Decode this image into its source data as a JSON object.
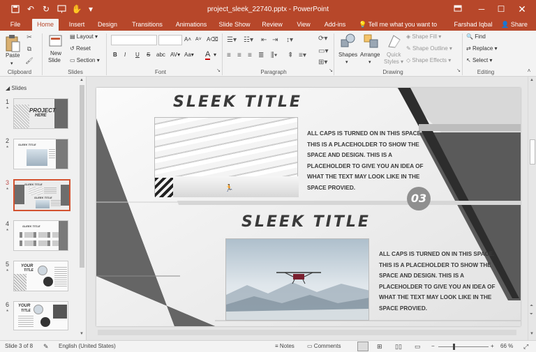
{
  "app": {
    "doc_title": "project_sleek_22740.pptx - PowerPoint",
    "user": "Farshad Iqbal",
    "share": "Share",
    "tell_me": "Tell me what you want to do..."
  },
  "tabs": [
    "File",
    "Home",
    "Insert",
    "Design",
    "Transitions",
    "Animations",
    "Slide Show",
    "Review",
    "View",
    "Add-ins"
  ],
  "ribbon": {
    "clipboard": {
      "label": "Clipboard",
      "paste": "Paste"
    },
    "slides": {
      "label": "Slides",
      "new_slide_1": "New",
      "new_slide_2": "Slide",
      "layout": "Layout",
      "reset": "Reset",
      "section": "Section"
    },
    "font": {
      "label": "Font",
      "bold": "B",
      "italic": "I",
      "underline": "U",
      "strike": "S",
      "shadow": "abc",
      "spacing": "AV",
      "case": "Aa",
      "grow": "A",
      "shrink": "A",
      "clear": "A",
      "color": "A"
    },
    "paragraph": {
      "label": "Paragraph"
    },
    "drawing": {
      "label": "Drawing",
      "shapes": "Shapes",
      "arrange": "Arrange",
      "quick_styles_1": "Quick",
      "quick_styles_2": "Styles",
      "shape_fill": "Shape Fill",
      "shape_outline": "Shape Outline",
      "shape_effects": "Shape Effects"
    },
    "editing": {
      "label": "Editing",
      "find": "Find",
      "replace": "Replace",
      "select": "Select"
    }
  },
  "slides_pane": {
    "header": "Slides",
    "items": [
      {
        "num": "1",
        "star": "*"
      },
      {
        "num": "2",
        "star": "*"
      },
      {
        "num": "3",
        "star": "*"
      },
      {
        "num": "4",
        "star": "*"
      },
      {
        "num": "5",
        "star": "*"
      },
      {
        "num": "6",
        "star": "*"
      }
    ],
    "thumb1_text_1": "PROJECT",
    "thumb1_text_2": "HERE",
    "thumb2_title": "SLEEK TITLE",
    "thumb3_title": "SLEEK TITLE",
    "thumb4_title": "SLEEK TITLE",
    "thumb5_title": "YOUR",
    "thumb5_title_2": "TITLE",
    "thumb6_title": "YOUR",
    "thumb6_title_2": "TITLE"
  },
  "slide": {
    "title_top": "SLEEK TITLE",
    "title_bottom": "SLEEK TITLE",
    "body_top": "ALL CAPS IS TURNED ON IN THIS SPACE. THIS IS A PLACEHOLDER TO SHOW THE SPACE AND DESIGN. THIS IS A PLACEHOLDER TO GIVE YOU AN IDEA OF WHAT THE TEXT MAY LOOK LIKE IN THE SPACE PROVIED.",
    "body_bottom": "ALL CAPS IS TURNED ON IN THIS SPACE. THIS IS A PLACEHOLDER TO SHOW THE SPACE AND DESIGN. THIS IS A PLACEHOLDER TO GIVE YOU AN IDEA OF WHAT THE TEXT MAY LOOK LIKE IN THE SPACE PROVIED.",
    "badge": "03"
  },
  "status": {
    "slide_of": "Slide 3 of 8",
    "language": "English (United States)",
    "notes": "Notes",
    "comments": "Comments",
    "zoom": "66 %",
    "zoom_level": 0.66
  },
  "colors": {
    "accent": "#b7472a",
    "active_thumb": "#d35230",
    "badge": "#8f8f8f"
  }
}
